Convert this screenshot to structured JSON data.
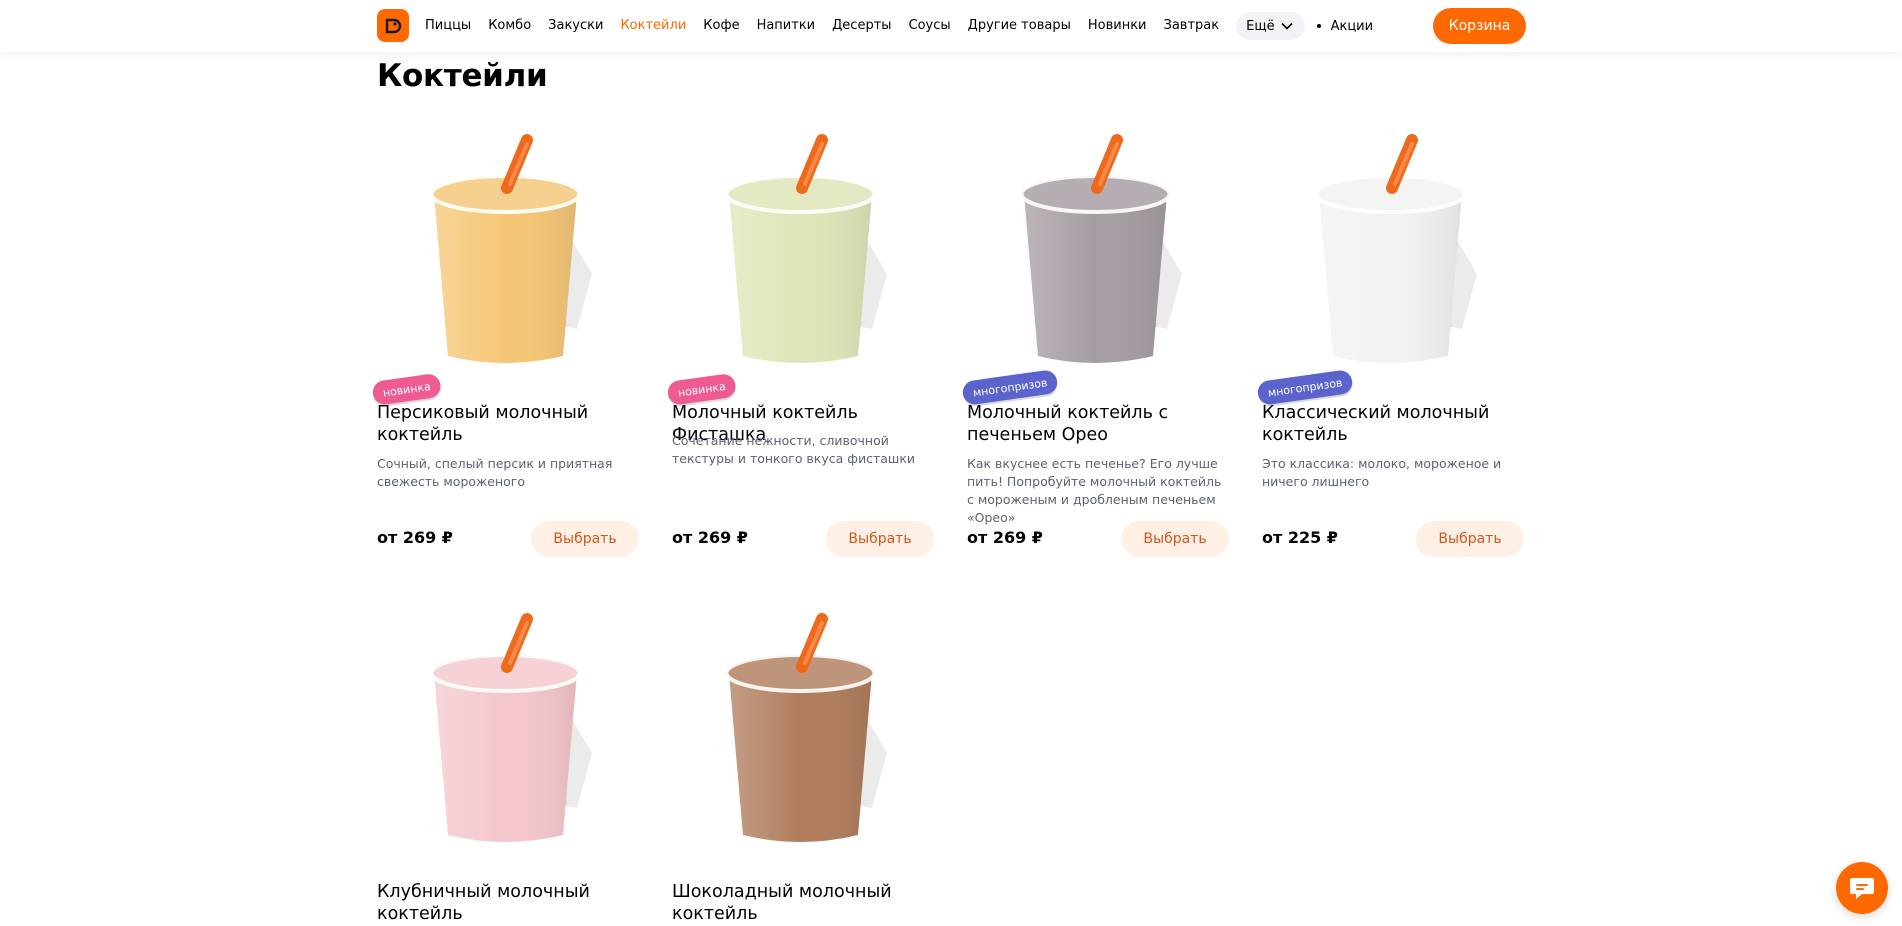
{
  "header": {
    "nav": [
      "Пиццы",
      "Комбо",
      "Закуски",
      "Коктейли",
      "Кофе",
      "Напитки",
      "Десерты",
      "Соусы",
      "Другие товары",
      "Новинки",
      "Завтрак"
    ],
    "active_nav": "Коктейли",
    "more_label": "Ещё",
    "promo_label": "Акции",
    "cart_label": "Корзина"
  },
  "page_title": "Коктейли",
  "products": [
    {
      "name": "Персиковый молочный коктейль",
      "description": "Сочный, спелый персик и приятная свежесть мороженого",
      "price": "от 269 ₽",
      "button": "Выбрать",
      "badge": "новинка",
      "drink_color": "#f5c676"
    },
    {
      "name": "Молочный коктейль Фисташка",
      "description": "Сочетание нежности, сливочной текстуры и тонкого вкуса фисташки",
      "price": "от 269 ₽",
      "button": "Выбрать",
      "badge": "новинка",
      "drink_color": "#dfe5b8"
    },
    {
      "name": "Молочный коктейль с печеньем Орео",
      "description": "Как вкуснее есть печенье? Его лучше пить! Попробуйте молочный коктейль с мороженым и дробленым печеньем «Орео»",
      "price": "от 269 ₽",
      "button": "Выбрать",
      "badge": "многопризов",
      "drink_color": "#a69ca4"
    },
    {
      "name": "Классический молочный коктейль",
      "description": "Это классика: молоко, мороженое и ничего лишнего",
      "price": "от 225 ₽",
      "button": "Выбрать",
      "badge": "многопризов",
      "drink_color": "#f2f2f0"
    },
    {
      "name": "Клубничный молочный коктейль",
      "description": "",
      "price": "",
      "button": "",
      "badge": "",
      "drink_color": "#f4c7cc"
    },
    {
      "name": "Шоколадный молочный коктейль",
      "description": "",
      "price": "",
      "button": "",
      "badge": "",
      "drink_color": "#b07d5d"
    }
  ],
  "colors": {
    "brand": "#ff6900",
    "new_badge": "#ee5b92",
    "multi_badge": "#5b63cc"
  }
}
